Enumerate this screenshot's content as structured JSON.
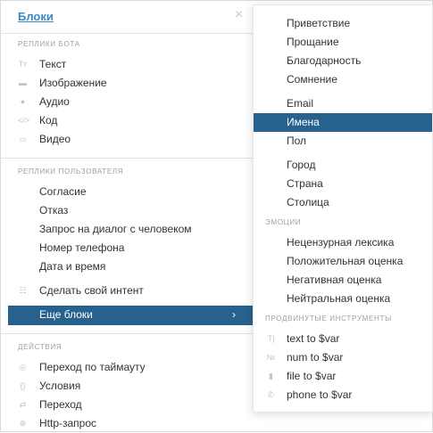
{
  "colors": {
    "accent": "#27628e",
    "link": "#3a8bc5",
    "muted": "#9aa0a6",
    "icon": "#c0c5cb"
  },
  "panel": {
    "title": "Блоки",
    "close_icon": "×",
    "bot_section": "РЕПЛИКИ БОТА",
    "bot_items": [
      {
        "label": "Текст",
        "icon": "text-icon",
        "glyph": "Tт"
      },
      {
        "label": "Изображение",
        "icon": "image-icon",
        "glyph": "▬"
      },
      {
        "label": "Аудио",
        "icon": "audio-icon",
        "glyph": "●"
      },
      {
        "label": "Код",
        "icon": "code-icon",
        "glyph": "</>"
      },
      {
        "label": "Видео",
        "icon": "video-icon",
        "glyph": "▭"
      }
    ],
    "user_section": "РЕПЛИКИ ПОЛЬЗОВАТЕЛЯ",
    "user_items": [
      {
        "label": "Согласие"
      },
      {
        "label": "Отказ"
      },
      {
        "label": "Запрос на диалог с человеком"
      },
      {
        "label": "Номер телефона"
      },
      {
        "label": "Дата и время"
      }
    ],
    "custom_intent": {
      "label": "Сделать свой интент",
      "icon": "intent-icon",
      "glyph": "☷"
    },
    "more_blocks": {
      "label": "Еще блоки",
      "chevron": "›"
    },
    "actions_section": "ДЕЙСТВИЯ",
    "action_items": [
      {
        "label": "Переход по таймауту",
        "icon": "timeout-icon",
        "glyph": "◎"
      },
      {
        "label": "Условия",
        "icon": "braces-icon",
        "glyph": "{}"
      },
      {
        "label": "Переход",
        "icon": "transition-icon",
        "glyph": "⇄"
      },
      {
        "label": "Http-запрос",
        "icon": "http-icon",
        "glyph": "⊕"
      }
    ]
  },
  "submenu": {
    "group1": [
      "Приветствие",
      "Прощание",
      "Благодарность",
      "Сомнение"
    ],
    "group2": [
      "Email",
      "Имена",
      "Пол"
    ],
    "group3": [
      "Город",
      "Страна",
      "Столица"
    ],
    "emotions_section": "ЭМОЦИИ",
    "emotions": [
      "Нецензурная лексика",
      "Положительная оценка",
      "Негативная оценка",
      "Нейтральная оценка"
    ],
    "advanced_section": "ПРОДВИНУТЫЕ ИНСТРУМЕНТЫ",
    "advanced": [
      {
        "label": "text to $var",
        "icon": "text-var-icon",
        "glyph": "T|"
      },
      {
        "label": "num to $var",
        "icon": "num-var-icon",
        "glyph": "№"
      },
      {
        "label": "file to $var",
        "icon": "file-var-icon",
        "glyph": "▮"
      },
      {
        "label": "phone to $var",
        "icon": "phone-var-icon",
        "glyph": "✆"
      }
    ]
  }
}
